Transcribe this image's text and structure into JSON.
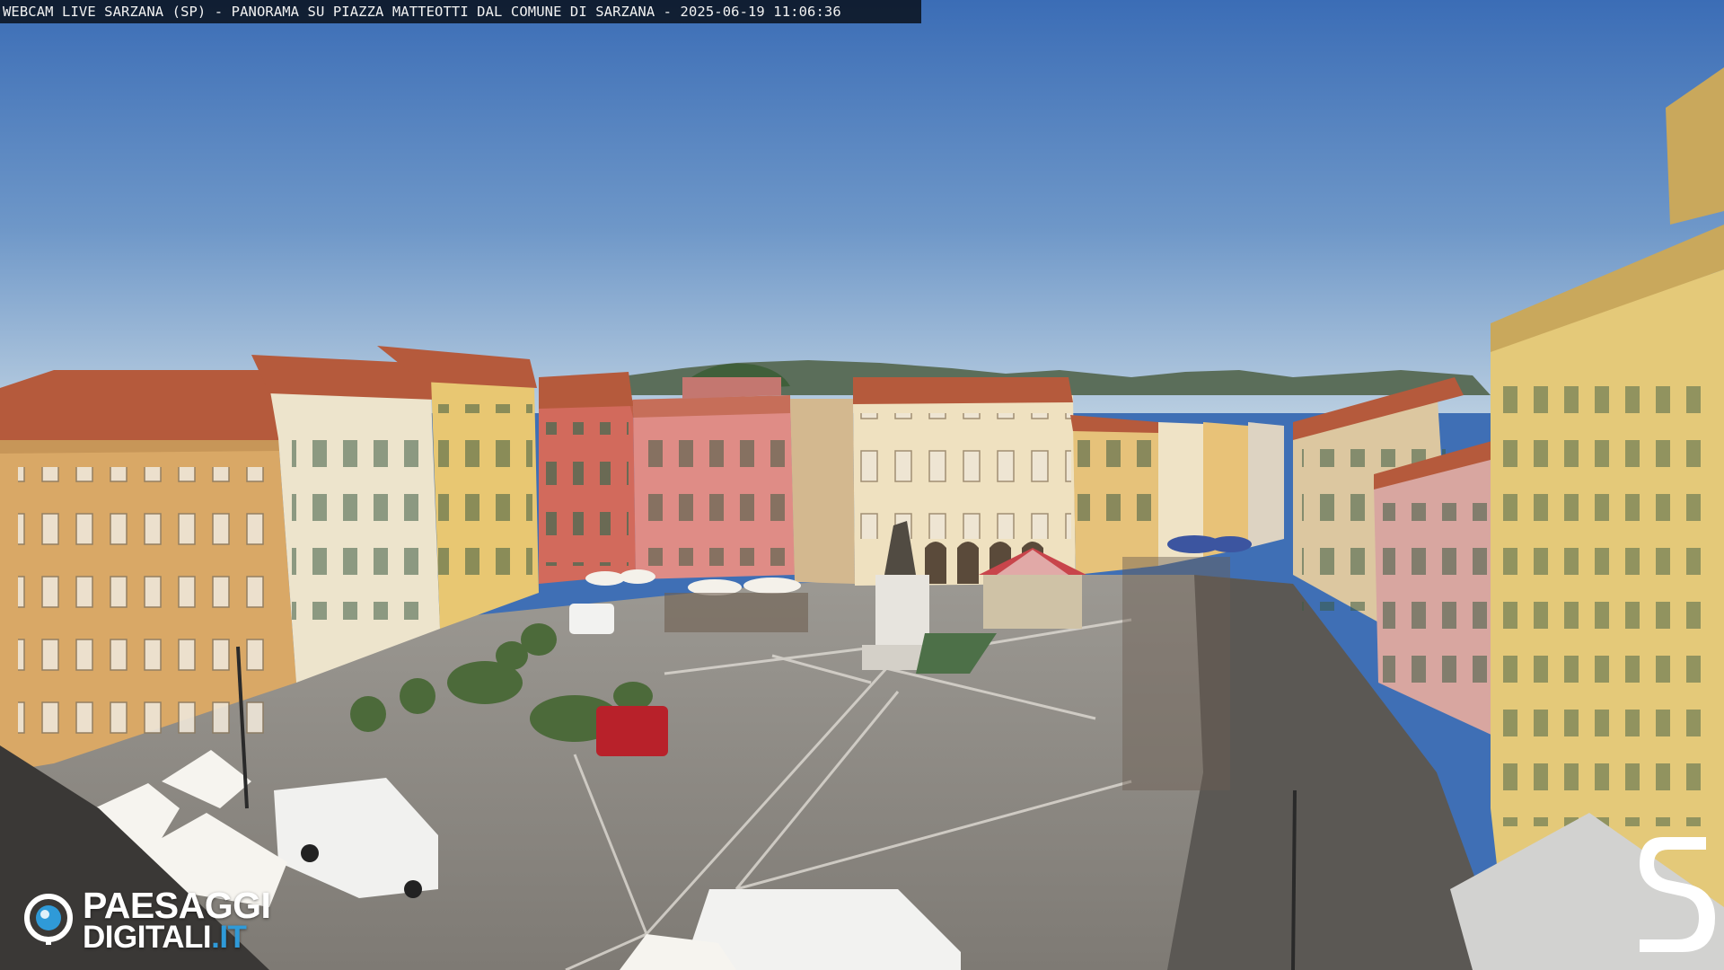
{
  "overlay": {
    "caption": "WEBCAM LIVE SARZANA (SP) - PANORAMA SU PIAZZA MATTEOTTI DAL COMUNE DI SARZANA - 2025-06-19  11:06:36",
    "brand_line1": "PAESAGGI",
    "brand_line2_main": "DIGITALI",
    "brand_line2_accent": ".IT",
    "brand_icon": "lens-icon",
    "corner_logo_icon": "s-logo-icon"
  },
  "colors": {
    "sky_top": "#3b6db6",
    "sky_horizon": "#b8cde0",
    "pavement": "#8e8a85",
    "building_ochre": "#d9a866",
    "building_red": "#d26a5c",
    "building_yellow": "#e8c772",
    "roof": "#b55a3c",
    "brand_accent": "#2f9ad8"
  }
}
